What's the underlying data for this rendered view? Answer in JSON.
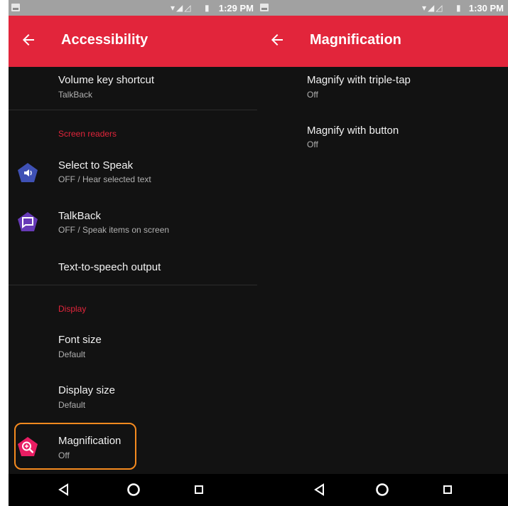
{
  "left_screen": {
    "status_bar": {
      "time": "1:29 PM",
      "icons": [
        "wifi-icon",
        "signal-icon",
        "battery-icon"
      ]
    },
    "app_bar": {
      "title": "Accessibility"
    },
    "items": [
      {
        "title": "Volume key shortcut",
        "summary": "TalkBack"
      },
      {
        "section": "Screen readers"
      },
      {
        "title": "Select to Speak",
        "summary": "OFF / Hear selected text",
        "icon": "speaker-icon",
        "icon_color": "#3f51b5"
      },
      {
        "title": "TalkBack",
        "summary": "OFF / Speak items on screen",
        "icon": "chat-bubble-icon",
        "icon_color": "#673ab7"
      },
      {
        "title": "Text-to-speech output"
      },
      {
        "section": "Display"
      },
      {
        "title": "Font size",
        "summary": "Default"
      },
      {
        "title": "Display size",
        "summary": "Default"
      },
      {
        "title": "Magnification",
        "summary": "Off",
        "icon": "magnify-plus-icon",
        "icon_color": "#e91e63"
      }
    ],
    "highlight_color": "#f58a1f"
  },
  "right_screen": {
    "status_bar": {
      "time": "1:30 PM",
      "icons": [
        "wifi-icon",
        "signal-icon",
        "battery-icon"
      ]
    },
    "app_bar": {
      "title": "Magnification"
    },
    "items": [
      {
        "title": "Magnify with triple-tap",
        "summary": "Off"
      },
      {
        "title": "Magnify with button",
        "summary": "Off"
      }
    ]
  },
  "navigation_bar": {
    "buttons": [
      "back-triangle-icon",
      "home-circle-icon",
      "recents-square-icon"
    ]
  },
  "colors": {
    "accent": "#e2253b",
    "background": "#121212",
    "navbar": "#000000"
  }
}
